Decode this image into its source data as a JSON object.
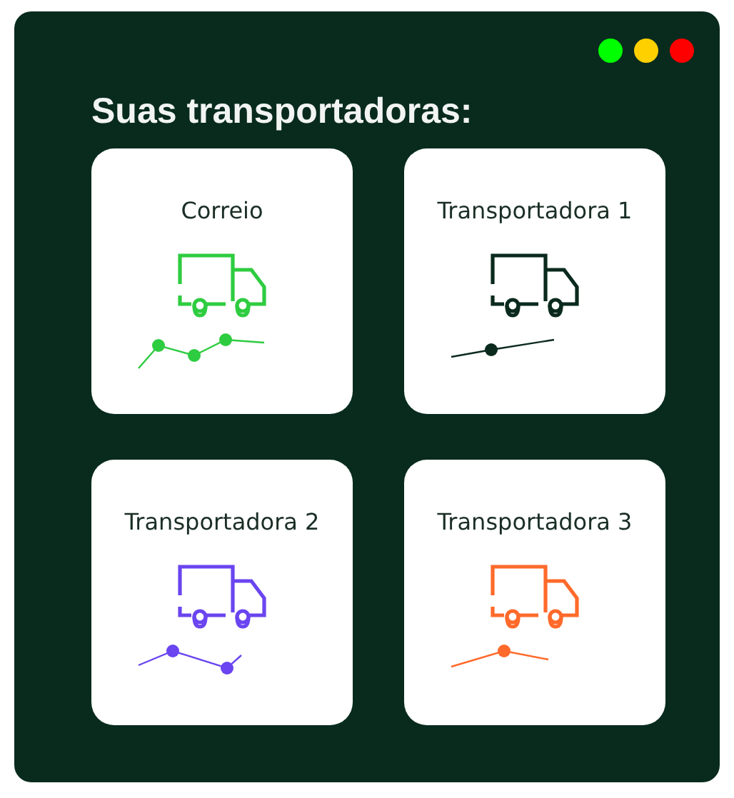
{
  "window_controls": [
    {
      "color": "#00ff00"
    },
    {
      "color": "#ffd000"
    },
    {
      "color": "#ff0000"
    }
  ],
  "title": "Suas transportadoras:",
  "carriers": [
    {
      "name": "Correio",
      "color": "#2ecc40"
    },
    {
      "name": "Transportadora 1",
      "color": "#0b2a1e"
    },
    {
      "name": "Transportadora 2",
      "color": "#6a45f0"
    },
    {
      "name": "Transportadora 3",
      "color": "#ff6a2b"
    }
  ]
}
